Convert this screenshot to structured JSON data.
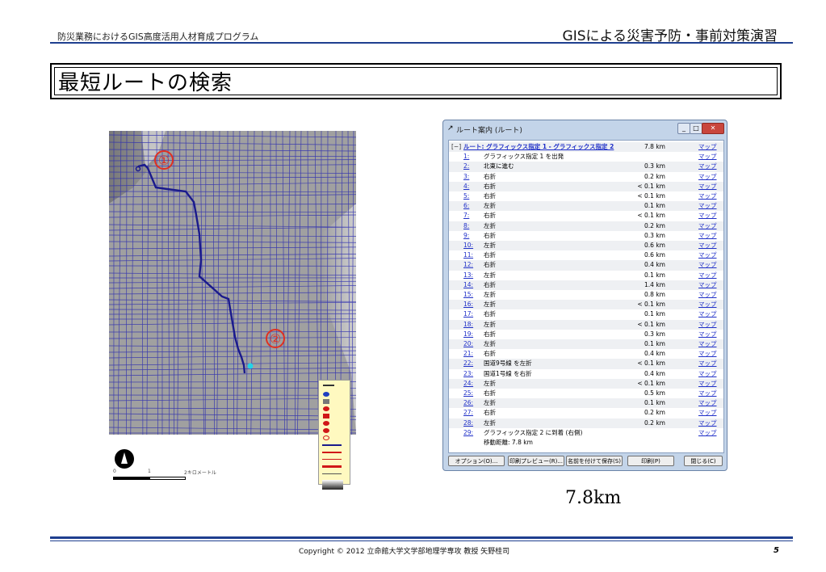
{
  "header": {
    "left": "防災業務におけるGIS高度活用人材育成プログラム",
    "right": "GISによる災害予防・事前対策演習"
  },
  "slide_title": "最短ルートの検索",
  "map": {
    "marker_start": "①",
    "marker_end": "②",
    "route_color": "#1a1a8c",
    "street_color": "#2b2bb0",
    "scale_label_start": "0",
    "scale_label_mid": "1",
    "scale_label_end": "2キロメートル",
    "north_arrow_icon": "north-arrow-icon"
  },
  "dialog": {
    "title": "ルート案内 (ルート)",
    "header_expand": "[−]",
    "header_route": "ルート: グラフィックス指定 1 - グラフィックス指定 2",
    "header_distance": "7.8 km",
    "map_link": "マップ",
    "steps": [
      {
        "num": "1:",
        "text": "グラフィックス指定 1 を出発",
        "dist": ""
      },
      {
        "num": "2:",
        "text": "北東に進む",
        "dist": "0.3 km"
      },
      {
        "num": "3:",
        "text": "右折",
        "dist": "0.2 km"
      },
      {
        "num": "4:",
        "text": "右折",
        "dist": "< 0.1 km"
      },
      {
        "num": "5:",
        "text": "右折",
        "dist": "< 0.1 km"
      },
      {
        "num": "6:",
        "text": "左折",
        "dist": "0.1 km"
      },
      {
        "num": "7:",
        "text": "右折",
        "dist": "< 0.1 km"
      },
      {
        "num": "8:",
        "text": "左折",
        "dist": "0.2 km"
      },
      {
        "num": "9:",
        "text": "右折",
        "dist": "0.3 km"
      },
      {
        "num": "10:",
        "text": "左折",
        "dist": "0.6 km"
      },
      {
        "num": "11:",
        "text": "右折",
        "dist": "0.6 km"
      },
      {
        "num": "12:",
        "text": "右折",
        "dist": "0.4 km"
      },
      {
        "num": "13:",
        "text": "左折",
        "dist": "0.1 km"
      },
      {
        "num": "14:",
        "text": "右折",
        "dist": "1.4 km"
      },
      {
        "num": "15:",
        "text": "左折",
        "dist": "0.8 km"
      },
      {
        "num": "16:",
        "text": "左折",
        "dist": "< 0.1 km"
      },
      {
        "num": "17:",
        "text": "右折",
        "dist": "0.1 km"
      },
      {
        "num": "18:",
        "text": "左折",
        "dist": "< 0.1 km"
      },
      {
        "num": "19:",
        "text": "右折",
        "dist": "0.3 km"
      },
      {
        "num": "20:",
        "text": "左折",
        "dist": "0.1 km"
      },
      {
        "num": "21:",
        "text": "右折",
        "dist": "0.4 km"
      },
      {
        "num": "22:",
        "text": "国道9号線 を左折",
        "dist": "< 0.1 km"
      },
      {
        "num": "23:",
        "text": "国道1号線 を右折",
        "dist": "0.4 km"
      },
      {
        "num": "24:",
        "text": "左折",
        "dist": "< 0.1 km"
      },
      {
        "num": "25:",
        "text": "右折",
        "dist": "0.5 km"
      },
      {
        "num": "26:",
        "text": "左折",
        "dist": "0.1 km"
      },
      {
        "num": "27:",
        "text": "右折",
        "dist": "0.2 km"
      },
      {
        "num": "28:",
        "text": "左折",
        "dist": "0.2 km"
      },
      {
        "num": "29:",
        "text": "グラフィックス指定 2 に到着 (右側)",
        "dist": ""
      }
    ],
    "total": "移動距離: 7.8 km",
    "buttons": {
      "options": "オプション(O)...",
      "print_preview": "印刷プレビュー(R)...",
      "save_as": "名前を付けて保存(S)",
      "print": "印刷(P)",
      "close": "閉じる(C)"
    }
  },
  "distance_label": "7.8km",
  "footer": {
    "copyright": "Copyright © 2012 立命館大学文学部地理学専攻 教授 矢野桂司",
    "page_number": "5"
  }
}
